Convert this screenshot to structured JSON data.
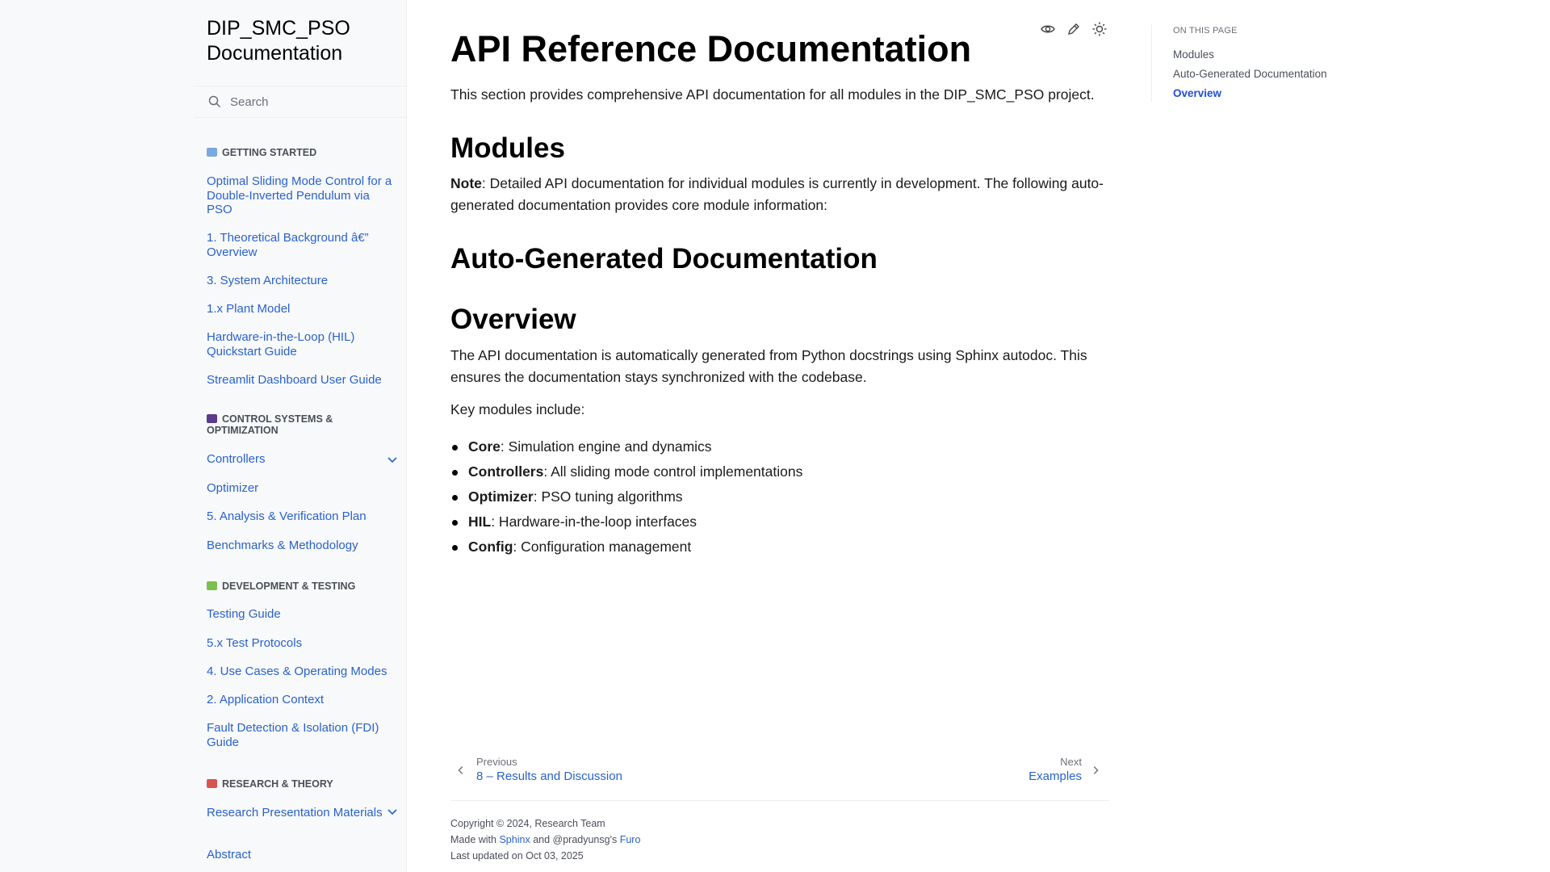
{
  "sidebar": {
    "brand": "DIP_SMC_PSO Documentation",
    "search_placeholder": "Search",
    "sections": [
      {
        "caption": "GETTING STARTED",
        "emoji_color": "#7aa7e0",
        "items": [
          "Optimal Sliding Mode Control for a Double-Inverted Pendulum via PSO",
          "1. Theoretical Background â€” Overview",
          "3. System Architecture",
          "1.x Plant Model",
          "Hardware-in-the-Loop (HIL) Quickstart Guide",
          "Streamlit Dashboard User Guide"
        ]
      },
      {
        "caption": "CONTROL SYSTEMS & OPTIMIZATION",
        "emoji_color": "#5b3b8c",
        "items": [
          "Controllers",
          "Optimizer",
          "5. Analysis & Verification Plan",
          "Benchmarks & Methodology"
        ]
      },
      {
        "caption": "DEVELOPMENT & TESTING",
        "emoji_color": "#7bbf4c",
        "items": [
          "Testing Guide",
          "5.x Test Protocols",
          "4. Use Cases & Operating Modes",
          "2. Application Context",
          "Fault Detection & Isolation (FDI) Guide"
        ]
      },
      {
        "caption": "RESEARCH & THEORY",
        "emoji_color": "#d9534f",
        "items": [
          "Research Presentation Materials",
          "Abstract"
        ]
      }
    ]
  },
  "main": {
    "title": "API Reference Documentation",
    "intro": "This section provides comprehensive API documentation for all modules in the DIP_SMC_PSO project.",
    "h_modules": "Modules",
    "note_label": "Note",
    "note_text": ": Detailed API documentation for individual modules is currently in development. The following auto-generated documentation provides core module information:",
    "h_autogen": "Auto-Generated Documentation",
    "h_overview": "Overview",
    "overview_text": "The API documentation is automatically generated from Python docstrings using Sphinx autodoc. This ensures the documentation stays synchronized with the codebase.",
    "key_modules": "Key modules include:",
    "modules": [
      {
        "name": "Core",
        "desc": ": Simulation engine and dynamics"
      },
      {
        "name": "Controllers",
        "desc": ": All sliding mode control implementations"
      },
      {
        "name": "Optimizer",
        "desc": ": PSO tuning algorithms"
      },
      {
        "name": "HIL",
        "desc": ": Hardware-in-the-loop interfaces"
      },
      {
        "name": "Config",
        "desc": ": Configuration management"
      }
    ]
  },
  "toc": {
    "title": "ON THIS PAGE",
    "items": [
      "Modules",
      "Auto-Generated Documentation",
      "Overview"
    ]
  },
  "pager": {
    "prev_label": "Previous",
    "prev_title": "8 – Results and Discussion",
    "next_label": "Next",
    "next_title": "Examples"
  },
  "footer": {
    "copyright": "Copyright © 2024, Research Team",
    "made_with": "Made with",
    "sphinx": "Sphinx",
    "and": "and @pradyunsg's",
    "furo": "Furo",
    "updated": "Last updated on Oct 03, 2025"
  },
  "icons": [
    "search-icon",
    "view-source-icon",
    "edit-icon",
    "theme-toggle-icon",
    "chevron-down-icon",
    "chevron-left-icon",
    "chevron-right-icon"
  ]
}
